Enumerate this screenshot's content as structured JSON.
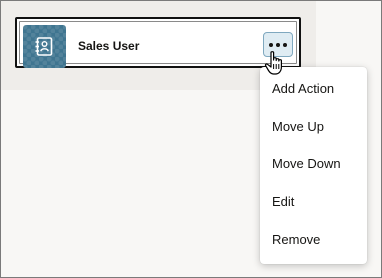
{
  "card": {
    "title": "Sales User",
    "icon": "contact-card-icon",
    "accent_color": "#3f7590"
  },
  "more_button": {
    "icon": "ellipsis-icon",
    "state": "hovered"
  },
  "menu": {
    "items": [
      {
        "label": "Add Action"
      },
      {
        "label": "Move Up"
      },
      {
        "label": "Move Down"
      },
      {
        "label": "Edit"
      },
      {
        "label": "Remove"
      }
    ]
  }
}
